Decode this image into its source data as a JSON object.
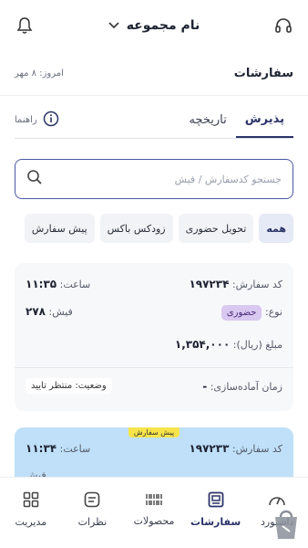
{
  "topbar": {
    "collection_name": "نام مجموعه"
  },
  "header": {
    "title": "سفارشات",
    "date": "امروز: ۸ مهر"
  },
  "tabs": [
    {
      "label": "پذیرش"
    },
    {
      "label": "تاریخچه"
    }
  ],
  "help_label": "راهنما",
  "search": {
    "placeholder": "جستجو کدسفارش / فیش"
  },
  "filters": [
    "همه",
    "تحویل حضوری",
    "زودکس باکس",
    "پیش سفارش"
  ],
  "orders": [
    {
      "code_label": "کد سفارش:",
      "code": "۱۹۷۲۳۴",
      "time_label": "ساعت:",
      "time": "۱۱:۳۵",
      "type_label": "نوع:",
      "type": "حضوری",
      "receipt_label": "فیش:",
      "receipt": "۲۷۸",
      "amount_label": "مبلغ (ریال):",
      "amount": "۱,۳۵۴,۰۰۰",
      "prep_label": "زمان آماده‌سازی:",
      "prep": "-",
      "status_label": "وضعیت:",
      "status": "منتظر تایید"
    },
    {
      "tag": "پیش سفارش",
      "code_label": "کد سفارش:",
      "code": "۱۹۷۲۳۳",
      "time_label": "ساعت:",
      "time": "۱۱:۳۴",
      "receipt_label": "فیش"
    }
  ],
  "nav": [
    {
      "label": "داشبورد",
      "icon": "gauge-icon"
    },
    {
      "label": "سفارشات",
      "icon": "orders-icon"
    },
    {
      "label": "محصولات",
      "icon": "barcode-icon"
    },
    {
      "label": "نظرات",
      "icon": "comment-icon"
    },
    {
      "label": "مدیریت",
      "icon": "grid-icon"
    }
  ],
  "colors": {
    "accent": "#2b3468",
    "search_border": "#4a57a6",
    "preorder_card": "#bfe0f8",
    "type_badge": "#d9c8f0",
    "preorder_tag": "#f6e44a"
  }
}
